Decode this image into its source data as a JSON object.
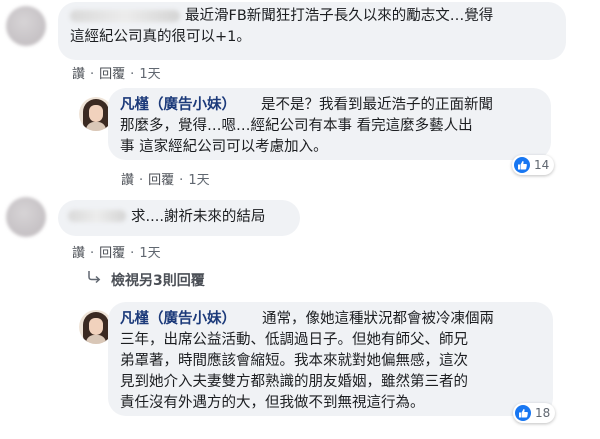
{
  "comment1": {
    "line1": "最近滑FB新聞狂打浩子長久以來的勵志文…覺得",
    "line2": "這經紀公司真的很可以+1。",
    "like": "讚",
    "reply": "回覆",
    "sep": "·",
    "time": "1天"
  },
  "reply1": {
    "author": "凡槿（廣告小妹）",
    "line1": "是不是？我看到最近浩子的正面新聞",
    "line2": "那麼多，覺得…嗯…經紀公司有本事 看完這麼多藝人出",
    "line3": "事 這家經紀公司可以考慮加入。",
    "like": "讚",
    "reply": "回覆",
    "sep": "·",
    "time": "1天",
    "reactions": "14"
  },
  "comment2": {
    "line1": "求....謝祈未來的結局",
    "like": "讚",
    "reply": "回覆",
    "sep": "·",
    "time": "1天"
  },
  "view_more": {
    "label": "檢視另3則回覆"
  },
  "reply2": {
    "author": "凡槿（廣告小妹）",
    "line1": "通常，像她這種狀況都會被冷凍個兩",
    "line2": "三年，出席公益活動、低調過日子。但她有師父、師兄",
    "line3": "弟罩著，時間應該會縮短。我本來就對她偏無感，這次",
    "line4": "見到她介入夫妻雙方都熟識的朋友婚姻，雖然第三者的",
    "line5": "責任沒有外遇方的大，但我做不到無視這行為。",
    "reactions": "18"
  },
  "colors": {
    "bubble": "#f0f2f5",
    "link": "#4b4f56",
    "name": "#1c3a7a",
    "like_blue": "#1877f2"
  }
}
